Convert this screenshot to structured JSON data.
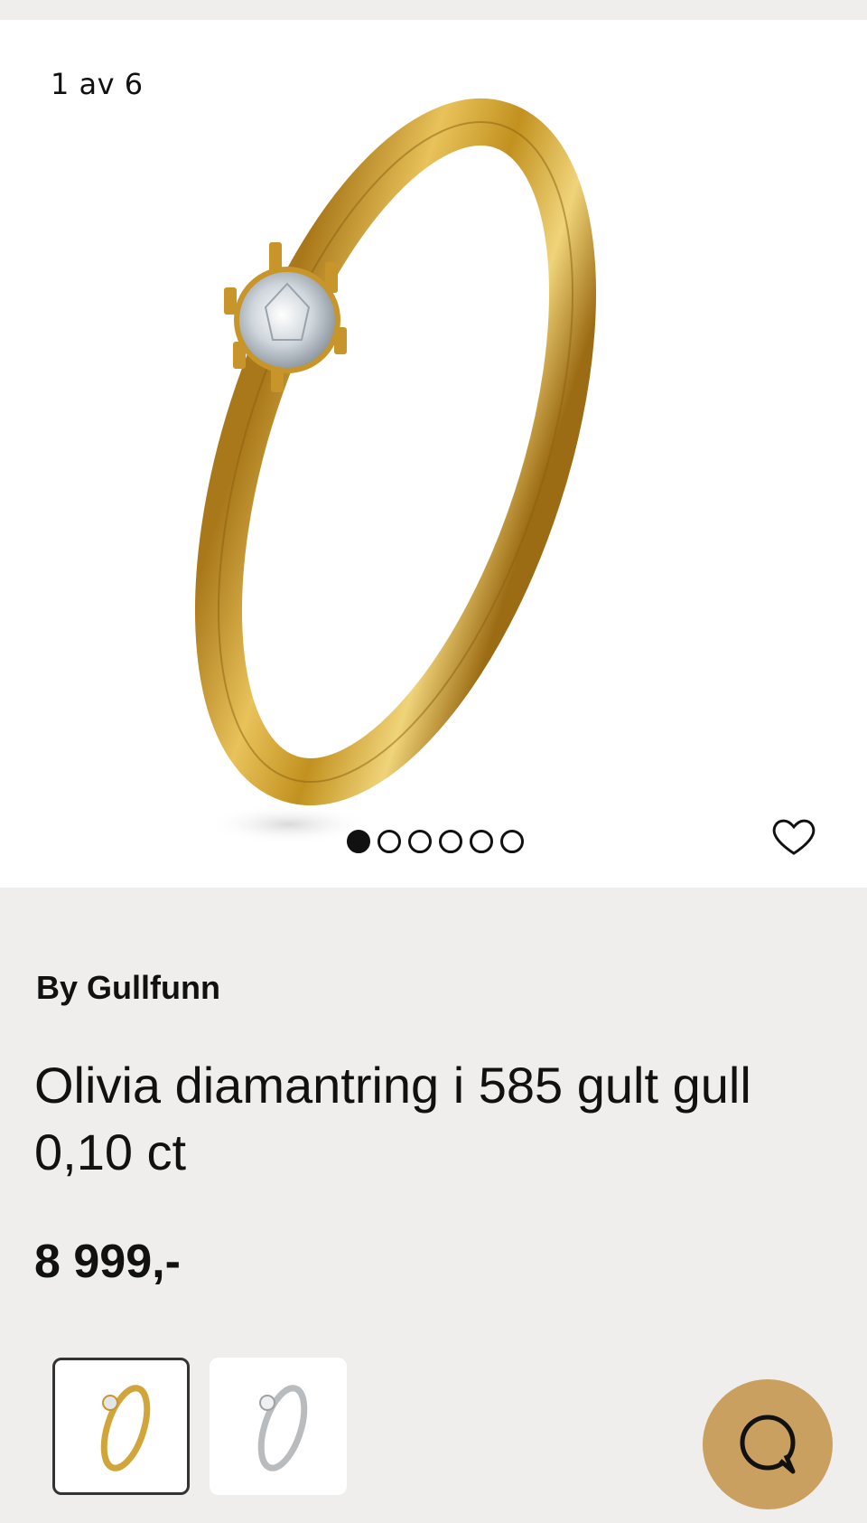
{
  "gallery": {
    "counter": "1 av 6",
    "image_count": 6,
    "active_index": 0
  },
  "product": {
    "brand": "By Gullfunn",
    "title": "Olivia diamantring i 585 gult gull 0,10 ct",
    "price": "8 999,-"
  },
  "variants": [
    {
      "name": "gult gull",
      "selected": true
    },
    {
      "name": "hvitt gull",
      "selected": false
    }
  ],
  "icons": {
    "favorite": "heart-outline-icon",
    "chat": "chat-bubble-icon"
  },
  "colors": {
    "background": "#efeeec",
    "gold": "#c9a060",
    "text": "#111111"
  }
}
